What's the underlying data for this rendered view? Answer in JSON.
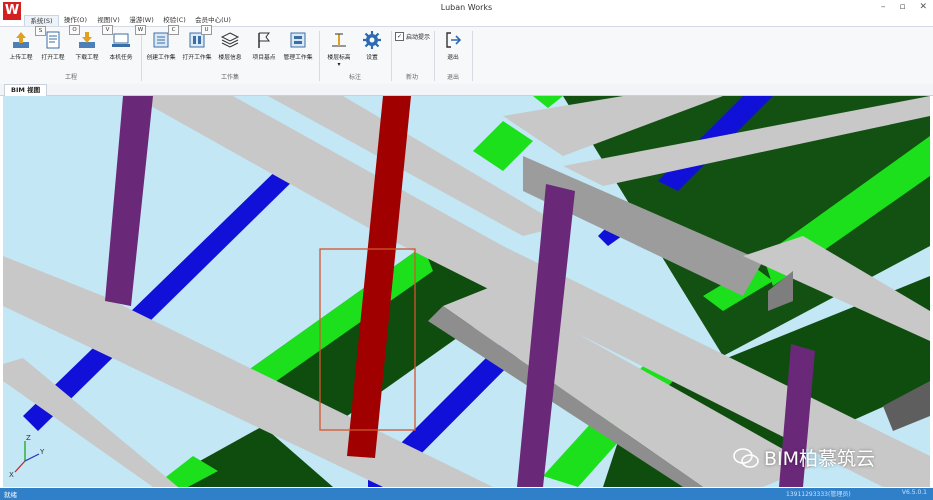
{
  "app": {
    "title": "Luban Works",
    "logo_letter": "W"
  },
  "window_controls": [
    "–",
    "▫",
    "✕"
  ],
  "menu": [
    {
      "label": "系统(S)",
      "key": "S",
      "active": true
    },
    {
      "label": "操作(O)",
      "key": "O"
    },
    {
      "label": "视图(V)",
      "key": "V"
    },
    {
      "label": "漫游(W)",
      "key": "W"
    },
    {
      "label": "校验(C)",
      "key": "C"
    },
    {
      "label": "会员中心(U)",
      "key": "U"
    }
  ],
  "ribbon": {
    "groups": {
      "project": "工程",
      "workset": "工作集",
      "marking": "标注",
      "guide": "新功",
      "exit": "退出"
    },
    "buttons": {
      "upload": "上传工程",
      "open": "打开工程",
      "download": "下载工程",
      "local_task": "本机任务",
      "create_workset": "创建工作集",
      "open_workset": "打开工作集",
      "floor_info": "楼层信息",
      "base_point": "项目基点",
      "manage_workset": "管理工作集",
      "elevation_marker": "楼层标高",
      "settings": "设置",
      "exit": "退出"
    },
    "auto_hint": {
      "label": "启动提示",
      "checked": true
    }
  },
  "view_tab": "BIM 视图",
  "axes": {
    "x": "X",
    "y": "Y",
    "z": "Z"
  },
  "status": {
    "left": "就绪",
    "middle": "13911293333(管理员)",
    "version": "V6.5.0.1"
  },
  "watermark": "BIM柏慕筑云",
  "colors": {
    "accent": "#2f7fc9",
    "logo": "#d32020",
    "beam": "#c8c8c8",
    "pipe": "#1010d8",
    "slab": "#1de01d",
    "column_red": "#a00000",
    "column_purple": "#6a2878",
    "selection": "#d0562e"
  }
}
